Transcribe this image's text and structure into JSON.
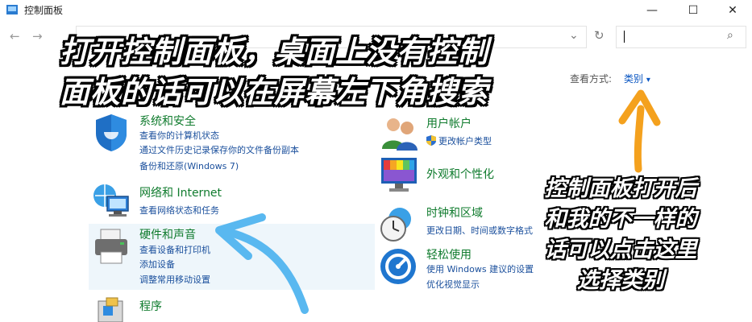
{
  "window": {
    "title": "控制面板",
    "minimize": "—",
    "maximize": "☐",
    "close": "✕"
  },
  "nav": {
    "back": "←",
    "forward": "→",
    "dropdown": "⌄",
    "refresh": "↻",
    "search_glyph": "⌕"
  },
  "view": {
    "label": "查看方式:",
    "value": "类别",
    "arrow": "▾"
  },
  "left_categories": [
    {
      "title": "系统和安全",
      "links": [
        "查看你的计算机状态",
        "通过文件历史记录保存你的文件备份副本",
        "备份和还原(Windows 7)"
      ]
    },
    {
      "title": "网络和 Internet",
      "links": [
        "查看网络状态和任务"
      ]
    },
    {
      "title": "硬件和声音",
      "links": [
        "查看设备和打印机",
        "添加设备",
        "调整常用移动设置"
      ]
    },
    {
      "title": "程序",
      "links": []
    }
  ],
  "right_categories": [
    {
      "title": "用户帐户",
      "links": [
        "更改帐户类型"
      ]
    },
    {
      "title": "外观和个性化",
      "links": []
    },
    {
      "title": "时钟和区域",
      "links": [
        "更改日期、时间或数字格式"
      ]
    },
    {
      "title": "轻松使用",
      "links": [
        "使用 Windows 建议的设置",
        "优化视觉显示"
      ]
    }
  ],
  "annotations": {
    "main_line1": "打开控制面板，桌面上没有控制",
    "main_line2": "面板的话可以在屏幕左下角搜索",
    "side_lines": [
      "控制面板打开后",
      "和我的不一样的",
      "话可以点击这里",
      "选择类别"
    ]
  },
  "colors": {
    "category_title": "#0f7b2d",
    "link": "#1a4f9c",
    "view_value": "#0a56c2",
    "orange_arrow": "#f4a11e",
    "blue_arrow": "#59b8f0"
  }
}
